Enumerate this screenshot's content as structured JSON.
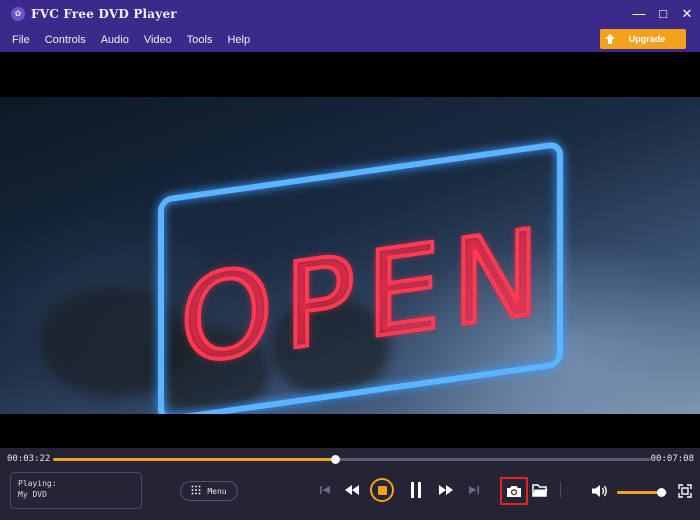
{
  "window": {
    "title": "FVC Free DVD Player",
    "logo_glyph": "✿",
    "minimize_glyph": "—",
    "maximize_glyph": "□",
    "close_glyph": "✕"
  },
  "menu": {
    "items": [
      "File",
      "Controls",
      "Audio",
      "Video",
      "Tools",
      "Help"
    ],
    "upgrade_label": "Upgrade"
  },
  "video": {
    "sign_letters": [
      "O",
      "P",
      "E",
      "N"
    ]
  },
  "playback": {
    "current_time": "00:03:22",
    "total_time": "00:07:08",
    "progress": 0.472,
    "playing_label": "Playing:",
    "playing_title": "My DVD",
    "menu_label": "Menu",
    "volume": 0.88
  },
  "colors": {
    "titlebar": "#3b2a8a",
    "accent": "#f4a21d",
    "highlight": "#e8201f",
    "neon_blue": "#5ab4ff",
    "neon_red": "#ff3a52"
  },
  "icons": {
    "prev": "skip-previous-icon",
    "rewind": "rewind-icon",
    "stop": "stop-icon",
    "pause": "pause-icon",
    "forward": "fast-forward-icon",
    "next": "skip-next-icon",
    "snapshot": "camera-icon",
    "open": "folder-icon",
    "volume": "volume-icon",
    "fullscreen": "fullscreen-icon"
  }
}
